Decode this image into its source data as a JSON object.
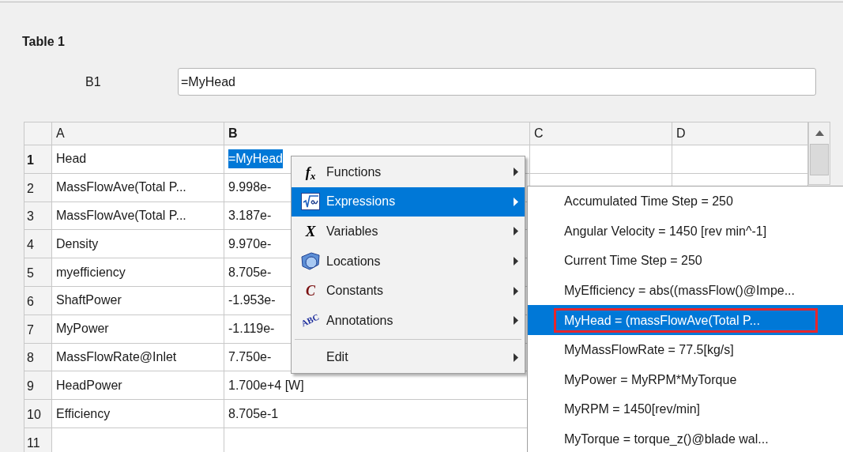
{
  "panel": {
    "title": "Table 1"
  },
  "cell_editor": {
    "label": "B1",
    "value": "=MyHead"
  },
  "table": {
    "columns": [
      {
        "label": "A",
        "current": false
      },
      {
        "label": "B",
        "current": true
      },
      {
        "label": "C",
        "current": false
      },
      {
        "label": "D",
        "current": false
      }
    ],
    "rows": [
      {
        "number": "1",
        "current": true,
        "cells": [
          {
            "text": "Head",
            "selected": false
          },
          {
            "text": "=MyHead",
            "selected": true
          }
        ]
      },
      {
        "number": "2",
        "current": false,
        "cells": [
          {
            "text": "MassFlowAve(Total P...",
            "selected": false
          },
          {
            "text": "9.998e-",
            "selected": false
          }
        ]
      },
      {
        "number": "3",
        "current": false,
        "cells": [
          {
            "text": "MassFlowAve(Total P...",
            "selected": false
          },
          {
            "text": "3.187e-",
            "selected": false
          }
        ]
      },
      {
        "number": "4",
        "current": false,
        "cells": [
          {
            "text": "Density",
            "selected": false
          },
          {
            "text": "9.970e-",
            "selected": false
          }
        ]
      },
      {
        "number": "5",
        "current": false,
        "cells": [
          {
            "text": "myefficiency",
            "selected": false
          },
          {
            "text": "8.705e-",
            "selected": false
          }
        ]
      },
      {
        "number": "6",
        "current": false,
        "cells": [
          {
            "text": "ShaftPower",
            "selected": false
          },
          {
            "text": "-1.953e-",
            "selected": false
          }
        ]
      },
      {
        "number": "7",
        "current": false,
        "cells": [
          {
            "text": "MyPower",
            "selected": false
          },
          {
            "text": "-1.119e-",
            "selected": false
          }
        ]
      },
      {
        "number": "8",
        "current": false,
        "cells": [
          {
            "text": "MassFlowRate@Inlet",
            "selected": false
          },
          {
            "text": "7.750e-",
            "selected": false
          }
        ]
      },
      {
        "number": "9",
        "current": false,
        "cells": [
          {
            "text": "HeadPower",
            "selected": false
          },
          {
            "text": "1.700e+4 [W]",
            "selected": false
          }
        ]
      },
      {
        "number": "10",
        "current": false,
        "cells": [
          {
            "text": "Efficiency",
            "selected": false
          },
          {
            "text": "8.705e-1",
            "selected": false
          }
        ]
      },
      {
        "number": "11",
        "current": false
      }
    ]
  },
  "context_menu": {
    "items": [
      {
        "kind": "glyph",
        "glyph": "f$_{x}$",
        "label": "Functions",
        "selected": false
      },
      {
        "kind": "image",
        "label": "Expressions",
        "selected": true
      },
      {
        "kind": "glyph",
        "glyph": "X",
        "label": "Variables",
        "selected": false
      },
      {
        "kind": "image",
        "label": "Locations",
        "selected": false
      },
      {
        "kind": "glyph",
        "glyph": "C",
        "label": "Constants",
        "selected": false
      },
      {
        "kind": "glyph",
        "glyph": "ABC",
        "label": "Annotations",
        "selected": false
      },
      {
        "kind": "separator"
      },
      {
        "kind": "plain",
        "label": "Edit",
        "selected": false
      }
    ]
  },
  "submenu": {
    "items": [
      {
        "label": "Accumulated Time Step = 250",
        "selected": false,
        "outlined": false
      },
      {
        "label": "Angular Velocity = 1450 [rev min^-1]",
        "selected": false,
        "outlined": false
      },
      {
        "label": "Current Time Step = 250",
        "selected": false,
        "outlined": false
      },
      {
        "label": "MyEfficiency = abs((massFlow()@Impe...",
        "selected": false,
        "outlined": false
      },
      {
        "label": "MyHead = (massFlowAve(Total P...",
        "selected": true,
        "outlined": true
      },
      {
        "label": "MyMassFlowRate = 77.5[kg/s]",
        "selected": false,
        "outlined": false
      },
      {
        "label": "MyPower = MyRPM*MyTorque",
        "selected": false,
        "outlined": false
      },
      {
        "label": "MyRPM = 1450[rev/min]",
        "selected": false,
        "outlined": false
      },
      {
        "label": "MyTorque = torque_z()@blade wal...",
        "selected": false,
        "outlined": false
      }
    ]
  }
}
